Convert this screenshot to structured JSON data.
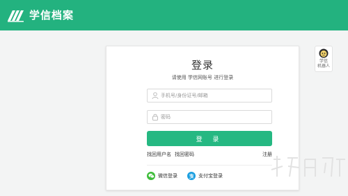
{
  "header": {
    "brand_title": "学信档案",
    "bg_color": "#23b27f"
  },
  "login": {
    "title": "登录",
    "subtitle": "请使用 学信网账号 进行登录",
    "username_placeholder": "手机号/身份证号/邮箱",
    "password_placeholder": "密码",
    "submit_label": "登 录",
    "find_username": "找回用户名",
    "find_password": "找回密码",
    "register": "注册",
    "wechat_login": "微信登录",
    "alipay_login": "支付宝登录",
    "accent_color": "#25b882"
  },
  "robot": {
    "line1": "学信",
    "line2": "机器人"
  },
  "icons": {
    "brand": "book-logo-icon",
    "user": "user-icon",
    "lock": "lock-icon",
    "wechat": "wechat-icon",
    "alipay": "alipay-icon",
    "robot": "robot-avatar-icon"
  }
}
